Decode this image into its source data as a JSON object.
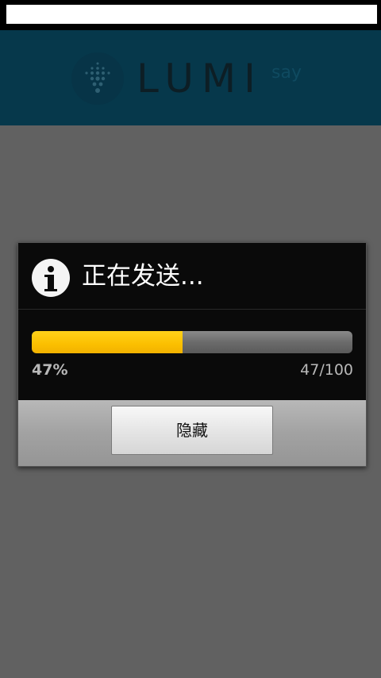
{
  "app": {
    "logo_text": "LUMI",
    "logo_suffix": "say"
  },
  "dialog": {
    "icon": "info-icon",
    "title": "正在发送...",
    "progress": {
      "percent_label": "47%",
      "count_label": "47/100",
      "fraction": 0.47,
      "fill_color": "#fbbf00"
    },
    "hide_button_label": "隐藏"
  }
}
